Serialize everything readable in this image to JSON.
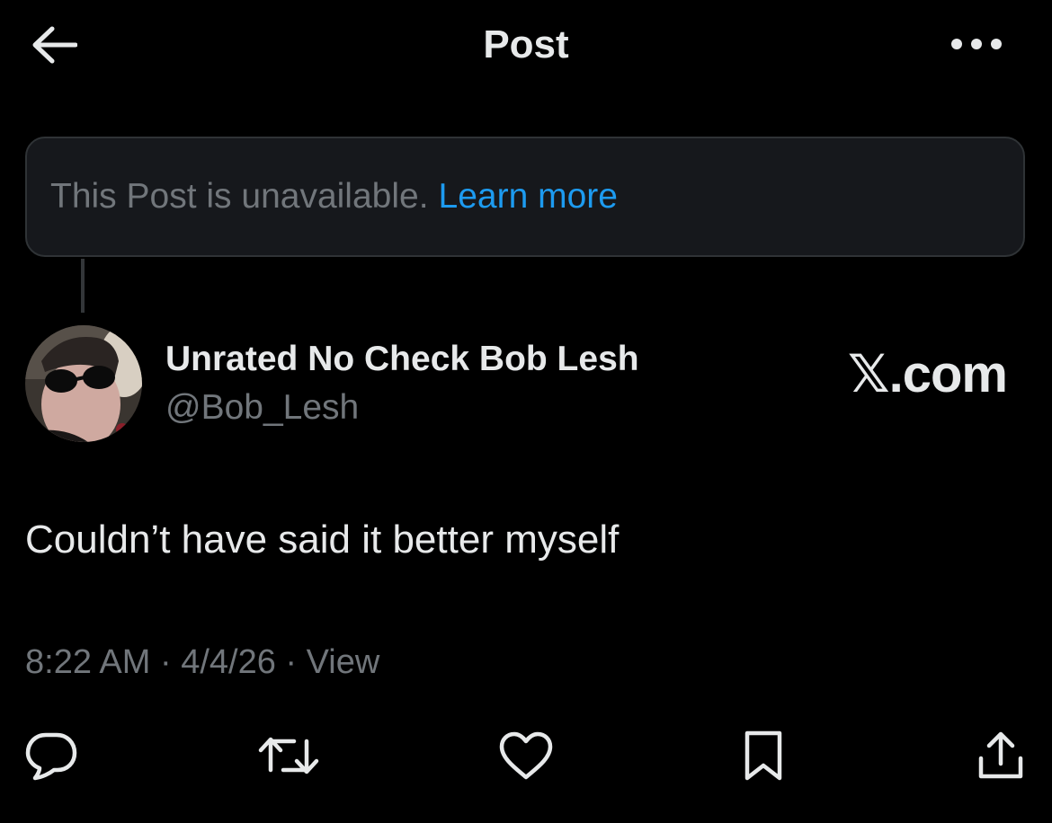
{
  "header": {
    "title": "Post",
    "back_icon": "arrow-left-icon",
    "more_icon": "more-horizontal-icon"
  },
  "notice": {
    "text": "This Post is unavailable.",
    "link": "Learn more"
  },
  "author": {
    "display_name": "Unrated No Check Bob Lesh",
    "handle": "@Bob_Lesh",
    "avatar_icon": "user-avatar"
  },
  "watermark": "𝕏.com",
  "post": {
    "text": "Couldn’t have said it better myself"
  },
  "meta": {
    "time": "8:22 AM",
    "sep1": " · ",
    "date": "4/4/26",
    "sep2": " · ",
    "view": "View"
  },
  "actions": [
    {
      "icon": "reply-icon"
    },
    {
      "icon": "repost-icon"
    },
    {
      "icon": "like-icon"
    },
    {
      "icon": "bookmark-icon"
    },
    {
      "icon": "share-icon"
    }
  ],
  "colors": {
    "background": "#000000",
    "text": "#e7e9ea",
    "secondary": "#71767b",
    "link": "#1d9bf0",
    "notice_bg": "#16181c",
    "border": "#2f3336"
  }
}
